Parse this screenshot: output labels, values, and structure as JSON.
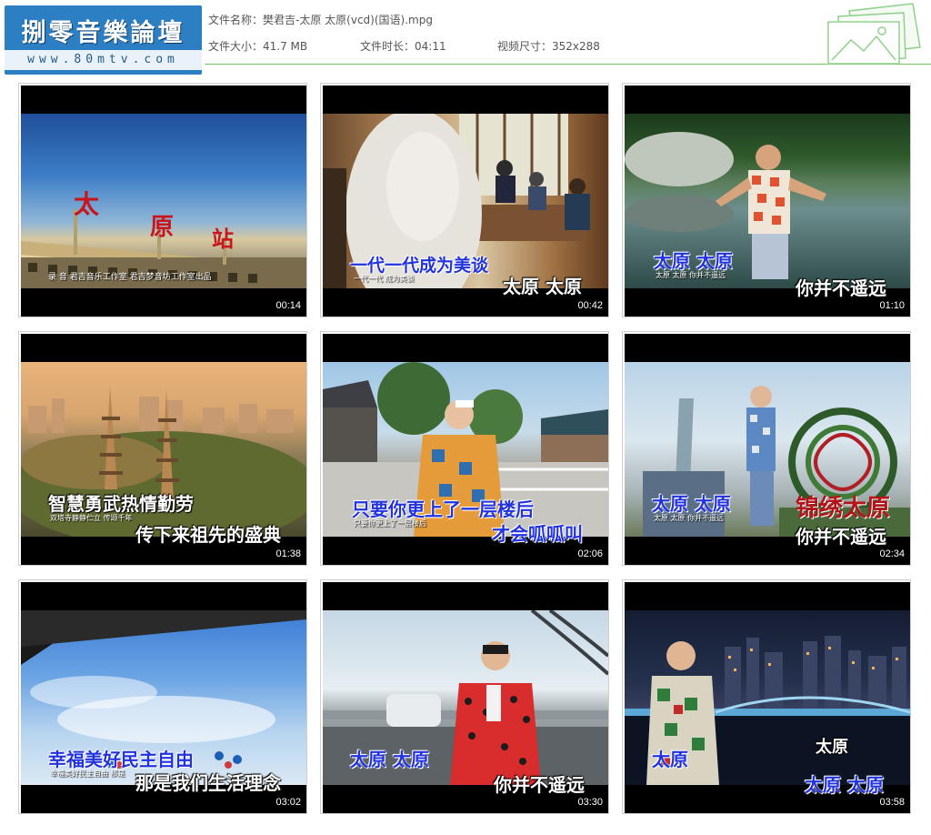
{
  "logo": {
    "title": "捌零音樂論壇",
    "url": "www.80mtv.com"
  },
  "file": {
    "name_label": "文件名称：",
    "name_value": "樊君吉-太原 太原(vcd)(国语).mpg",
    "size_label": "文件大小：",
    "size_value": "41.7 MB",
    "duration_label": "文件时长：",
    "duration_value": "04:11",
    "dims_label": "视频尺寸：",
    "dims_value": "352x288"
  },
  "thumbnails": [
    {
      "time": "00:14",
      "sign": [
        "太",
        "原",
        "站"
      ],
      "credit": "录  音  君吉音乐工作室   君吉梦音坊工作室出品"
    },
    {
      "time": "00:42",
      "line1": "一代一代成为美谈",
      "line2": "太原 太原",
      "small": "一代一代  成为美谈"
    },
    {
      "time": "01:10",
      "line1": "太原 太原",
      "line2": "你并不遥远",
      "small": "太原  太原  你并不遥远"
    },
    {
      "time": "01:38",
      "line1": "智慧勇武热情勤劳",
      "line2": "传下来祖先的盛典",
      "small": "双塔寺静静伫立 传颂千年"
    },
    {
      "time": "02:06",
      "line1": "只要你更上了一层楼后",
      "line2": "才会呱呱叫",
      "small": "只要你更上了一层楼后"
    },
    {
      "time": "02:34",
      "line1": "太原 太原",
      "line2": "你并不遥远",
      "small": "太原  太原  你并不遥远",
      "sign": "锦绣太原"
    },
    {
      "time": "03:02",
      "line1": "幸福美好民主自由",
      "line2": "那是我们生活理念",
      "small": "幸福美好民主自由  那是"
    },
    {
      "time": "03:30",
      "line1": "太原 太原",
      "line2": "你并不遥远"
    },
    {
      "time": "03:58",
      "line1": "太原",
      "line2": "太原 太原",
      "line3": "太原"
    }
  ],
  "colors": {
    "logo_bg": "#2c7fc3",
    "divider": "#7dbd6a",
    "lyric_blue": "#2233dd"
  }
}
